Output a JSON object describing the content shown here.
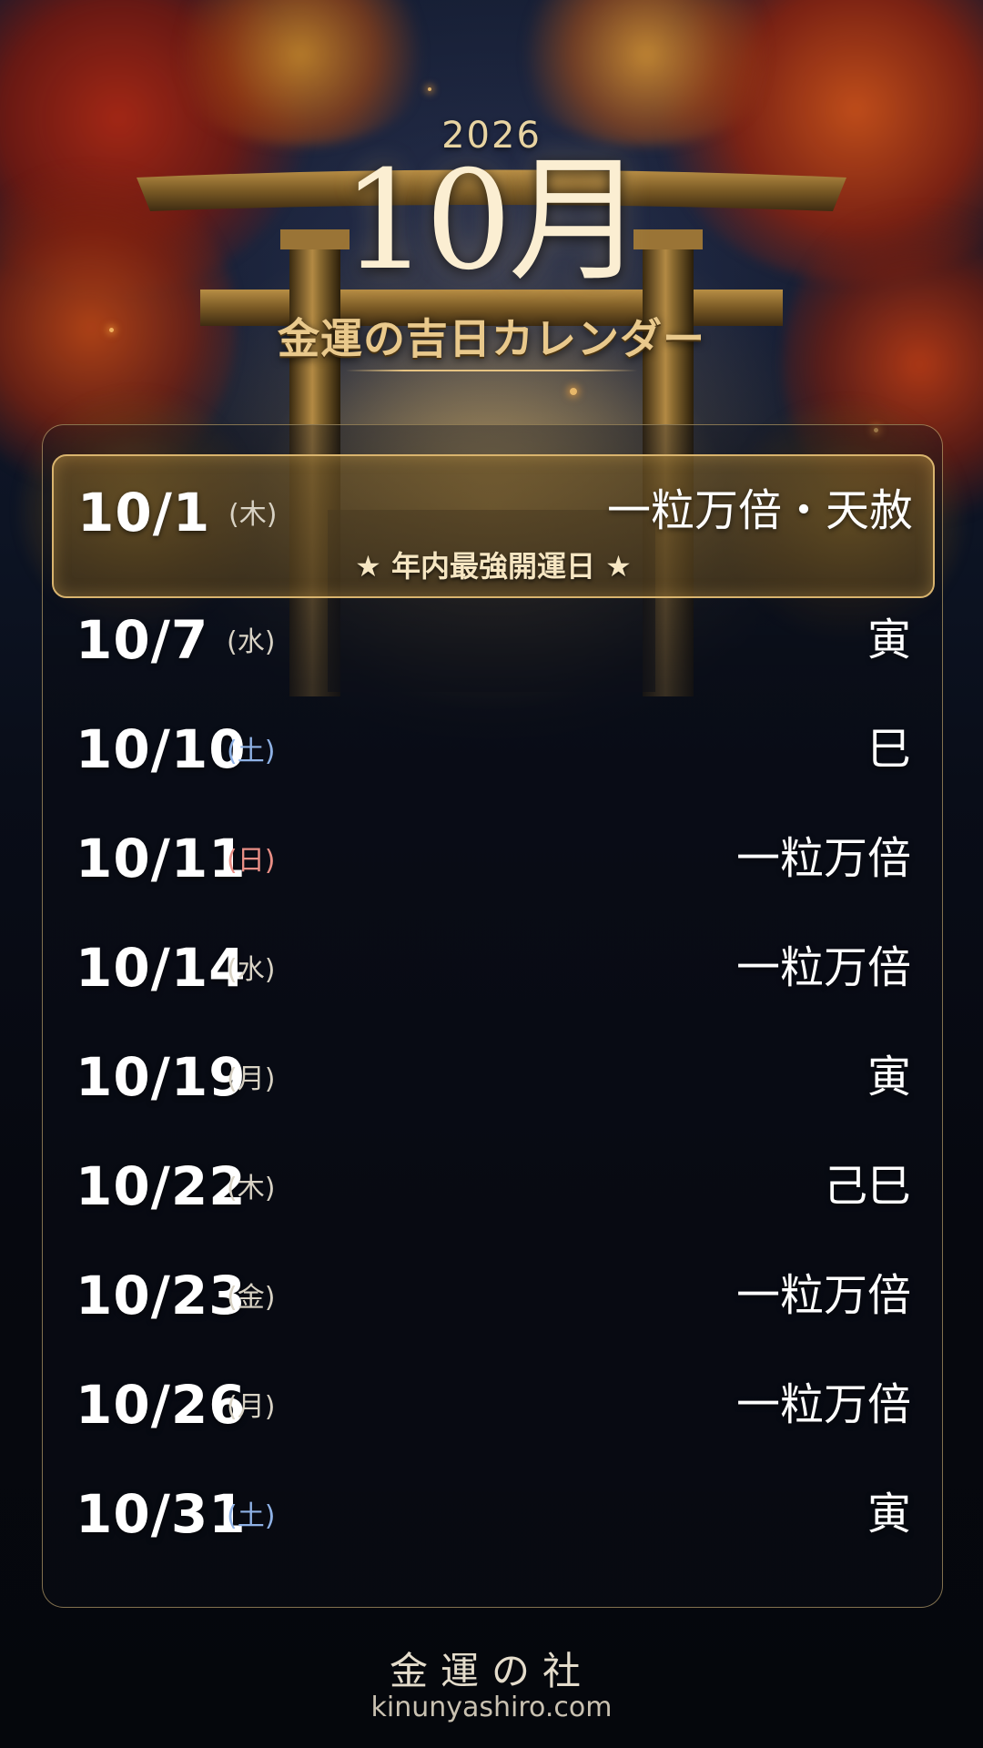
{
  "header": {
    "year": "2026",
    "month": "10月",
    "title": "金運の吉日カレンダー"
  },
  "calendar": {
    "highlight": {
      "date": "10/1",
      "weekday": "(木)",
      "type": "一粒万倍・天赦",
      "banner": "★ 年内最強開運日 ★"
    },
    "rows": [
      {
        "date": "10/7",
        "weekday": "(水)",
        "weekday_kind": "weekday",
        "type": "寅"
      },
      {
        "date": "10/10",
        "weekday": "(土)",
        "weekday_kind": "saturday",
        "type": "巳"
      },
      {
        "date": "10/11",
        "weekday": "(日)",
        "weekday_kind": "sunday",
        "type": "一粒万倍"
      },
      {
        "date": "10/14",
        "weekday": "(水)",
        "weekday_kind": "weekday",
        "type": "一粒万倍"
      },
      {
        "date": "10/19",
        "weekday": "(月)",
        "weekday_kind": "weekday",
        "type": "寅"
      },
      {
        "date": "10/22",
        "weekday": "(木)",
        "weekday_kind": "weekday",
        "type": "己巳"
      },
      {
        "date": "10/23",
        "weekday": "(金)",
        "weekday_kind": "weekday",
        "type": "一粒万倍"
      },
      {
        "date": "10/26",
        "weekday": "(月)",
        "weekday_kind": "weekday",
        "type": "一粒万倍"
      },
      {
        "date": "10/31",
        "weekday": "(土)",
        "weekday_kind": "saturday",
        "type": "寅"
      }
    ]
  },
  "footer": {
    "brand": "金運の社",
    "url": "kinunyashiro.com"
  },
  "colors": {
    "gold": "#d9b46e",
    "title_gold": "#e9c98c",
    "saturday_blue": "#8fb2e6",
    "sunday_red": "#e98f86",
    "background": "#070a12"
  }
}
